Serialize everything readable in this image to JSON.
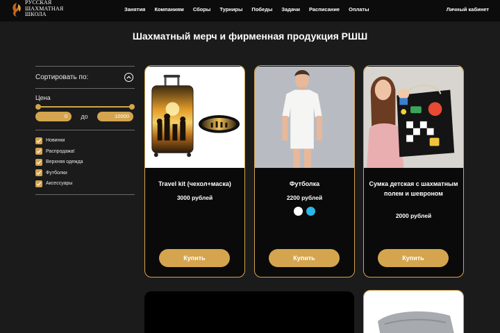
{
  "header": {
    "logo_lines": [
      "РУССКАЯ",
      "ШАХМАТНАЯ",
      "ШКОЛА"
    ],
    "nav": [
      "Занятия",
      "Компаниям",
      "Сборы",
      "Турниры",
      "Победы",
      "Задачи",
      "Расписание",
      "Оплаты"
    ],
    "cabinet": "Личный кабинет"
  },
  "page_title": "Шахматный мерч и фирменная продукция РШШ",
  "sidebar": {
    "sort_label": "Сортировать по:",
    "price_label": "Цена",
    "price_from": "0",
    "price_to_label": "до",
    "price_to": "10000",
    "categories": [
      "Новинки",
      "Распродажа!",
      "Верхняя одежда",
      "Футболки",
      "Аксессуары"
    ]
  },
  "products": [
    {
      "name": "Travel kit (чехол+маска)",
      "price": "3000 рублей",
      "button": "Купить"
    },
    {
      "name": "Футболка",
      "price": "2200 рублей",
      "button": "Купить",
      "colors": [
        "#ffffff",
        "#29b6e8"
      ]
    },
    {
      "name": "Сумка детская с шахматным полем и шевроном",
      "price": "2000 рублей",
      "button": "Купить"
    }
  ],
  "accent_color": "#d4a54e"
}
